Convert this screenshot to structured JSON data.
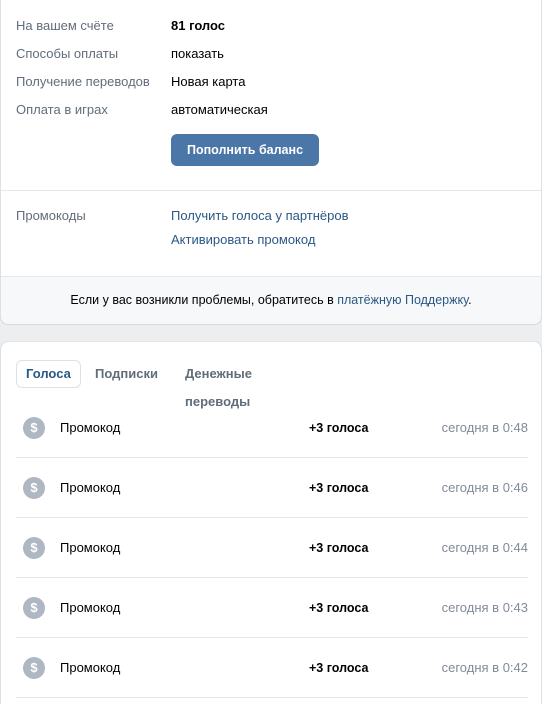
{
  "account": {
    "rows": [
      {
        "label": "На вашем счёте",
        "value": "81 голос"
      },
      {
        "label": "Способы оплаты",
        "value": "показать"
      },
      {
        "label": "Получение переводов",
        "value": "Новая карта"
      },
      {
        "label": "Оплата в играх",
        "value": "автоматическая"
      }
    ],
    "topup_button": "Пополнить баланс"
  },
  "promo": {
    "label": "Промокоды",
    "links": [
      "Получить голоса у партнёров",
      "Активировать промокод"
    ]
  },
  "notice": {
    "text_before": "Если у вас возникли проблемы, обратитесь в ",
    "link": "платёжную Поддержку",
    "text_after": "."
  },
  "tabs": [
    {
      "label": "Голоса",
      "active": true
    },
    {
      "label": "Подписки",
      "active": false
    },
    {
      "label": "Денежные переводы",
      "active": false
    }
  ],
  "transactions": [
    {
      "icon": "dollar-coin-icon",
      "title": "Промокод",
      "amount": "+3 голоса",
      "time": "сегодня в 0:48"
    },
    {
      "icon": "dollar-coin-icon",
      "title": "Промокод",
      "amount": "+3 голоса",
      "time": "сегодня в 0:46"
    },
    {
      "icon": "dollar-coin-icon",
      "title": "Промокод",
      "amount": "+3 голоса",
      "time": "сегодня в 0:44"
    },
    {
      "icon": "dollar-coin-icon",
      "title": "Промокод",
      "amount": "+3 голоса",
      "time": "сегодня в 0:43"
    },
    {
      "icon": "dollar-coin-icon",
      "title": "Промокод",
      "amount": "+3 голоса",
      "time": "сегодня в 0:42"
    }
  ],
  "colors": {
    "accent": "#4a76a8",
    "link": "#2a5885",
    "muted": "#626d7a",
    "icon_bg": "#aeb7c2"
  }
}
